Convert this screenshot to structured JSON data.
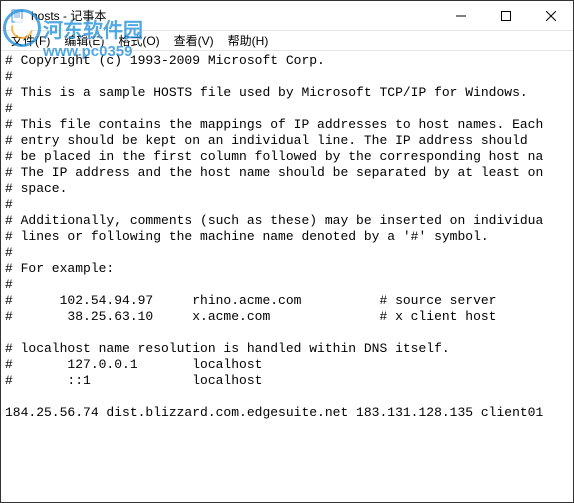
{
  "window": {
    "title": "hosts - 记事本"
  },
  "menu": {
    "file": "文件(F)",
    "edit": "编辑(E)",
    "format": "格式(O)",
    "view": "查看(V)",
    "help": "帮助(H)"
  },
  "content": {
    "lines": [
      "# Copyright (c) 1993-2009 Microsoft Corp.",
      "#",
      "# This is a sample HOSTS file used by Microsoft TCP/IP for Windows.",
      "#",
      "# This file contains the mappings of IP addresses to host names. Each",
      "# entry should be kept on an individual line. The IP address should",
      "# be placed in the first column followed by the corresponding host na",
      "# The IP address and the host name should be separated by at least on",
      "# space.",
      "#",
      "# Additionally, comments (such as these) may be inserted on individua",
      "# lines or following the machine name denoted by a '#' symbol.",
      "#",
      "# For example:",
      "#",
      "#      102.54.94.97     rhino.acme.com          # source server",
      "#       38.25.63.10     x.acme.com              # x client host",
      "",
      "# localhost name resolution is handled within DNS itself.",
      "#       127.0.0.1       localhost",
      "#       ::1             localhost",
      "",
      "184.25.56.74 dist.blizzard.com.edgesuite.net 183.131.128.135 client01"
    ]
  },
  "watermark": {
    "text": "河东软件园",
    "url": "www.pc0359"
  }
}
